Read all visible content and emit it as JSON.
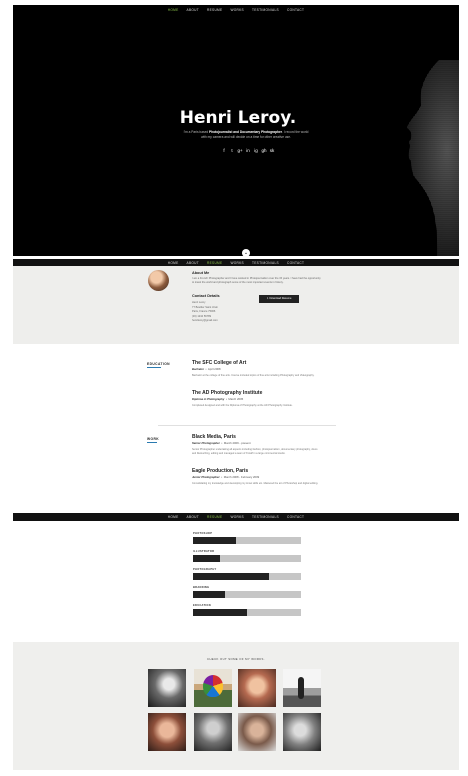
{
  "nav": {
    "items": [
      "Home",
      "About",
      "Resume",
      "Works",
      "Testimonials",
      "Contact"
    ],
    "active_hero": "Home",
    "active_nav3": "Resume"
  },
  "hero": {
    "title": "Henri Leroy.",
    "tagline_prefix": "I'm a Paris based ",
    "tagline_bold": "Photojournalist and Documentary Photographer",
    "tagline_suffix": ". I record the world with my camera and will decide on a time for other creative use.",
    "socials": [
      "f",
      "t",
      "g+",
      "in",
      "ig",
      "gh",
      "sk"
    ],
    "scroll_icon": "chevron-down-icon"
  },
  "about": {
    "heading": "About Me",
    "text": "I am a French Photographer and I have worked in Photojournalism over the 15 years. I have had the opportunity to travel the world and photograph some of the most important events in history.",
    "contact_heading": "Contact Details",
    "contact_lines": [
      "Henri Leroy",
      "77 Boulder Saint Ursin",
      "Paris, France 75006",
      "(33) 1234 56789",
      "henrileroy@gmail.com"
    ],
    "download_label": "Download Resume"
  },
  "resume": {
    "education_label": "Education",
    "work_label": "Work",
    "education": [
      {
        "title": "The SFC College of Art",
        "degree": "Bachelor",
        "date": "April 2008",
        "desc": "Bachelor at the college of fine arts. Course included topics of fine arts including Photography and Videography."
      },
      {
        "title": "The AD Photography Institute",
        "degree": "Diploma in Photography",
        "date": "March 2005",
        "desc": "Completed designed and with the Diploma of Photography at the AD Photography Institute."
      }
    ],
    "work": [
      {
        "title": "Black Media, Paris",
        "role": "Senior Photographer",
        "date": "March 2009 - present",
        "desc": "Senior Photographer undertaking all aspects including fashion, photojournalism, documentary photography, dress and Retouching, editing and managed a team of 8 staff in a large commercial studio."
      },
      {
        "title": "Eagle Production, Paris",
        "role": "Junior Photographer",
        "date": "March 2008 - February 2009",
        "desc": "Consolidating my knowledge and developing my know skills etc. Mastered the art of Photoshop and digital editing."
      }
    ]
  },
  "skills": [
    {
      "name": "Photoshop",
      "level": 0.4
    },
    {
      "name": "Illustrator",
      "level": 0.25
    },
    {
      "name": "Photography",
      "level": 0.7
    },
    {
      "name": "Branding",
      "level": 0.3
    },
    {
      "name": "Education",
      "level": 0.5
    }
  ],
  "gallery": {
    "heading": "Check out some of my works.",
    "items": [
      "Portrait of man",
      "Hot air balloon",
      "Woman portrait",
      "Outdoor scene",
      "Woman portrait 2",
      "Man portrait",
      "Young man portrait",
      "Woman portrait 3"
    ]
  }
}
